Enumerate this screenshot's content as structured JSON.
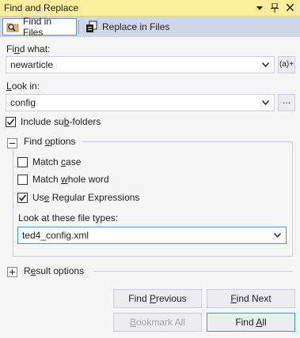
{
  "window": {
    "title": "Find and Replace",
    "dropdown_icon": "dropdown-arrow-icon",
    "pin_icon": "pin-icon",
    "close_icon": "close-icon"
  },
  "tabs": [
    {
      "label": "Find in Files",
      "icon": "find-in-files-icon",
      "active": true
    },
    {
      "label": "Replace in Files",
      "icon": "replace-in-files-icon",
      "active": false
    }
  ],
  "find_what": {
    "label_pre": "Fi",
    "label_key": "n",
    "label_post": "d what:",
    "value": "newarticle",
    "regex_builder_label": "(a)+"
  },
  "look_in": {
    "label_key": "L",
    "label_post": "ook in:",
    "value": "config",
    "browse_label": "..."
  },
  "include_subfolders": {
    "label_pre": "Include su",
    "label_key": "b",
    "label_post": "-folders",
    "checked": true
  },
  "find_options": {
    "label_pre": "Find ",
    "label_key": "o",
    "label_post": "ptions",
    "expanded": true,
    "match_case": {
      "label_pre": "Match ",
      "label_key": "c",
      "label_post": "ase",
      "checked": false
    },
    "match_whole_word": {
      "label_pre": "Match ",
      "label_key": "w",
      "label_post": "hole word",
      "checked": false
    },
    "use_regex": {
      "label_pre": "Us",
      "label_key": "e",
      "label_post": " Regular Expressions",
      "checked": true
    },
    "file_types_label": "Look at these file types:",
    "file_types_value": "ted4_config.xml"
  },
  "result_options": {
    "label_pre": "R",
    "label_key": "e",
    "label_post": "sult options",
    "expanded": false
  },
  "buttons": {
    "find_previous": {
      "pre": "Find ",
      "key": "P",
      "post": "revious"
    },
    "find_next": {
      "pre": "",
      "key": "F",
      "post": "ind Next"
    },
    "bookmark_all": {
      "pre": "",
      "key": "B",
      "post": "ookmark All",
      "enabled": false
    },
    "find_all": {
      "pre": "Find ",
      "key": "A",
      "post": "ll"
    }
  },
  "colors": {
    "titlebar": "#fcee9c",
    "tabbar": "#cfd6e5",
    "accent": "#3399ff"
  }
}
